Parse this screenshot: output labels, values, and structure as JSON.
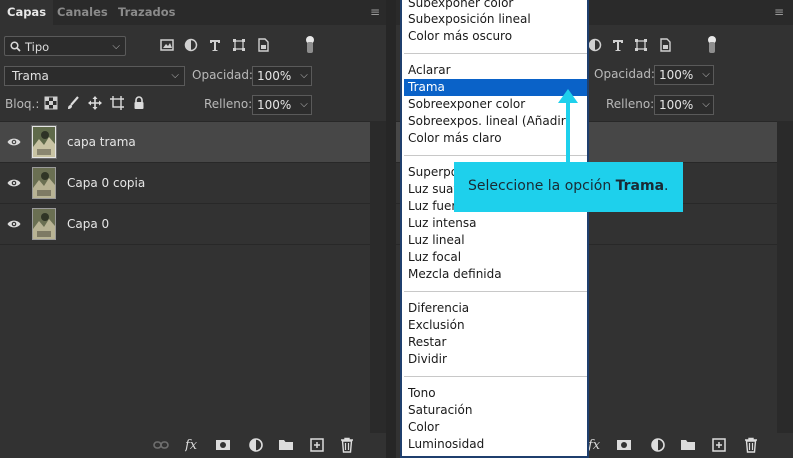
{
  "left_panel": {
    "tabs": [
      "Capas",
      "Canales",
      "Trazados"
    ],
    "filter": {
      "label": "Tipo"
    },
    "blend_mode": "Trama",
    "opacity_label": "Opacidad:",
    "opacity_value": "100%",
    "lock_label": "Bloq.:",
    "fill_label": "Relleno:",
    "fill_value": "100%",
    "layers": [
      {
        "name": "capa trama",
        "selected": true,
        "visible": true
      },
      {
        "name": "Capa 0 copia",
        "selected": false,
        "visible": true
      },
      {
        "name": "Capa 0",
        "selected": false,
        "visible": true
      }
    ],
    "footer_icons": [
      "link-icon",
      "fx-icon",
      "mask-icon",
      "adjustment-icon",
      "folder-icon",
      "new-layer-icon",
      "trash-icon"
    ]
  },
  "right_panel": {
    "opacity_label": "Opacidad:",
    "opacity_value": "100%",
    "fill_label": "Relleno:",
    "fill_value": "100%"
  },
  "blend_dropdown": {
    "groups": [
      [
        "Subexponer color",
        "Subexposición lineal",
        "Color más oscuro"
      ],
      [
        "Aclarar",
        "Trama",
        "Sobreexponer color",
        "Sobreexpos. lineal (Añadir)",
        "Color más claro"
      ],
      [
        "Superponer",
        "Luz suave",
        "Luz fuerte",
        "Luz intensa",
        "Luz lineal",
        "Luz focal",
        "Mezcla definida"
      ],
      [
        "Diferencia",
        "Exclusión",
        "Restar",
        "Dividir"
      ],
      [
        "Tono",
        "Saturación",
        "Color",
        "Luminosidad"
      ]
    ],
    "highlighted": "Trama"
  },
  "callout": {
    "text_before": "Seleccione la opción ",
    "text_bold": "Trama",
    "text_after": "."
  },
  "colors": {
    "panel_bg": "#323232",
    "selected_layer": "#474747",
    "highlight_blue": "#0a62c8",
    "callout_cyan": "#1ed0ec"
  }
}
